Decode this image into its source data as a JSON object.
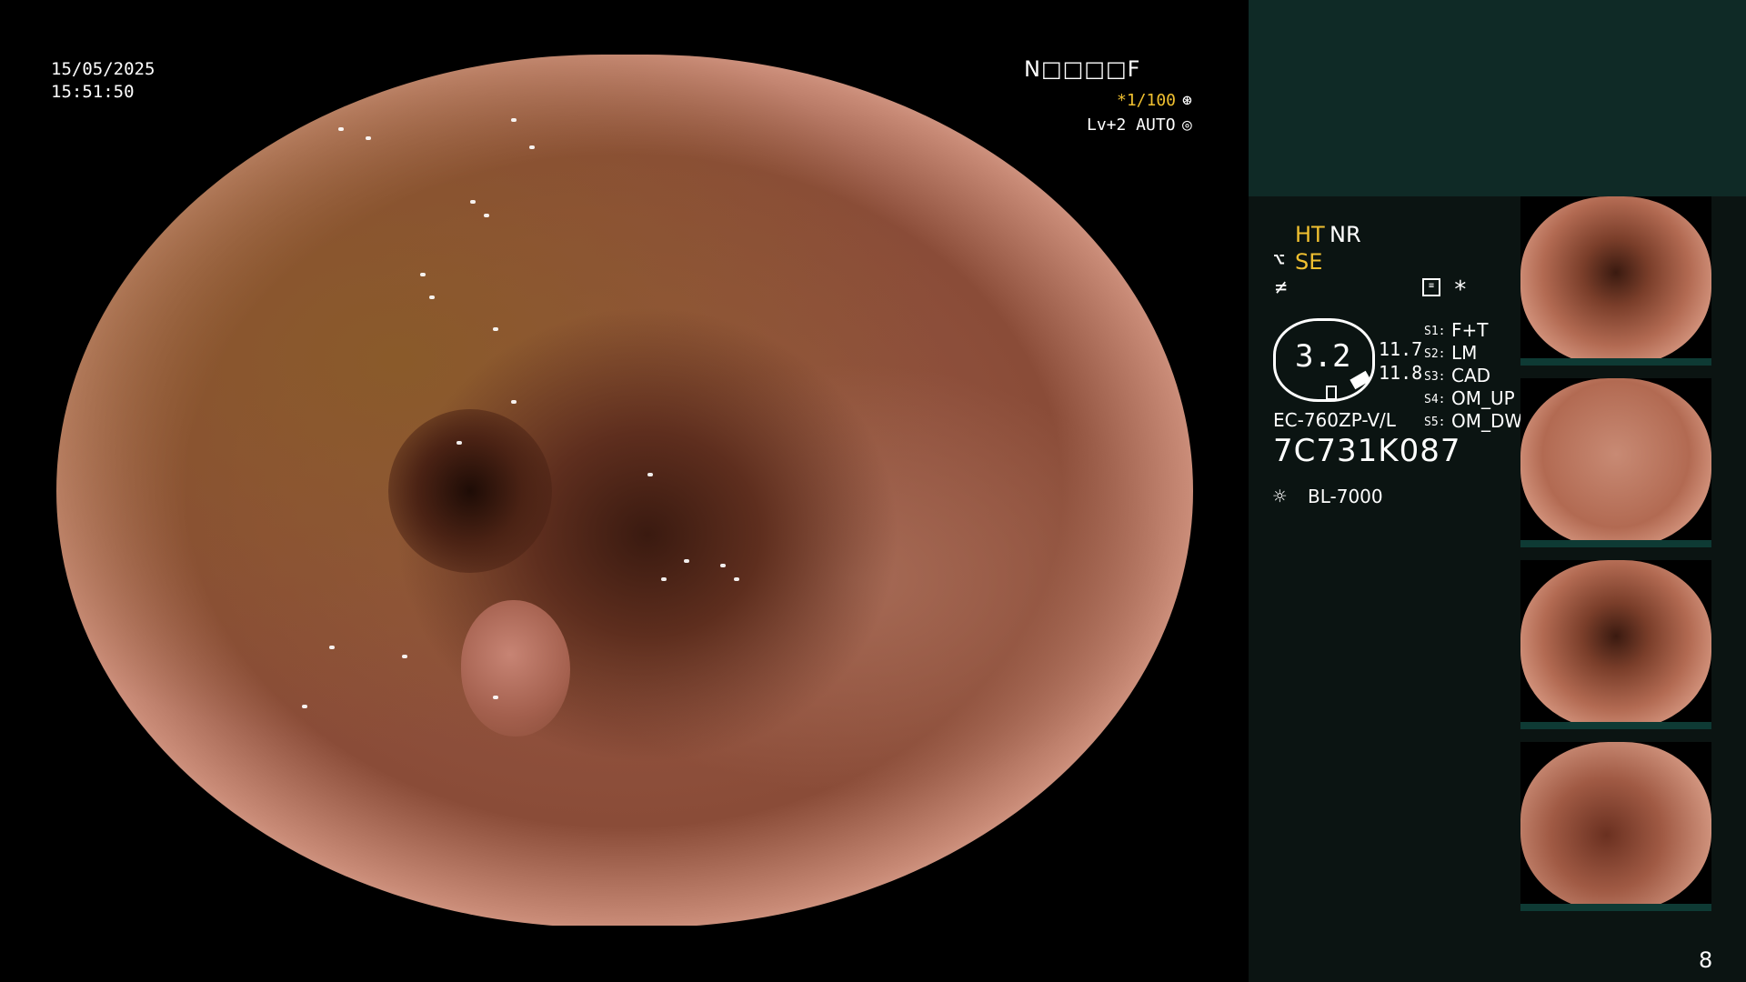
{
  "overlay": {
    "date": "15/05/2025",
    "time": "15:51:50",
    "scope_code": "N□□□□F",
    "zoom": "*1/100",
    "zoom_icon": "⊛",
    "level": "Lv+2 AUTO",
    "level_icon": "◎"
  },
  "panel": {
    "ht": "HT",
    "nr": "NR",
    "se_icon": "⌥",
    "se": "SE",
    "freeze_icon": "≠",
    "star": "*",
    "dial_value": "3.2",
    "values": [
      "11.7",
      "11.8"
    ],
    "switches": [
      {
        "label": "S1:",
        "value": "F+T"
      },
      {
        "label": "S2:",
        "value": "LM"
      },
      {
        "label": "S3:",
        "value": "CAD"
      },
      {
        "label": "S4:",
        "value": "OM_UP"
      },
      {
        "label": "S5:",
        "value": "OM_DW"
      }
    ],
    "model": "EC-760ZP-V/L",
    "serial": "7C731K087",
    "light_icon": "☼",
    "light": "BL-7000"
  },
  "page_number": "8"
}
